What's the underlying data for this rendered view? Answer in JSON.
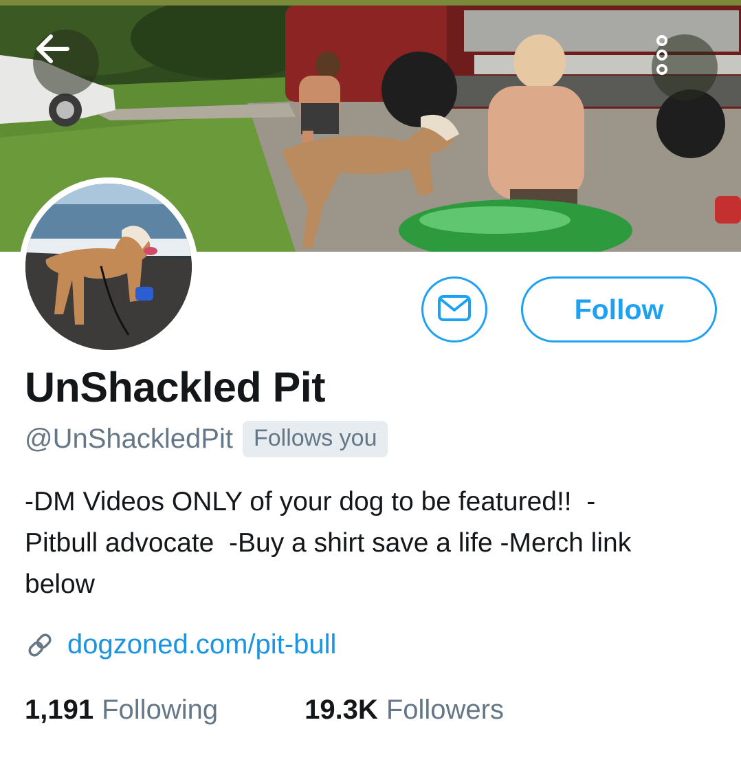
{
  "header": {
    "back_icon": "arrow-left-icon",
    "more_icon": "more-vertical-icon"
  },
  "profile": {
    "display_name": "UnShackled Pit",
    "handle": "@UnShackledPit",
    "follows_you_badge": "Follows you",
    "bio": "-DM Videos ONLY of your dog to be featured!!  -\nPitbull advocate  -Buy a shirt save a life -Merch link\nbelow",
    "website": "dogzoned.com/pit-bull",
    "link_icon": "link-icon"
  },
  "actions": {
    "message_icon": "envelope-icon",
    "follow_label": "Follow"
  },
  "stats": {
    "following_count": "1,191",
    "following_label": "Following",
    "followers_count": "19.3K",
    "followers_label": "Followers"
  },
  "colors": {
    "accent": "#1da1f2",
    "link": "#1b95e0",
    "secondary_text": "#657786",
    "primary_text": "#14171a"
  }
}
